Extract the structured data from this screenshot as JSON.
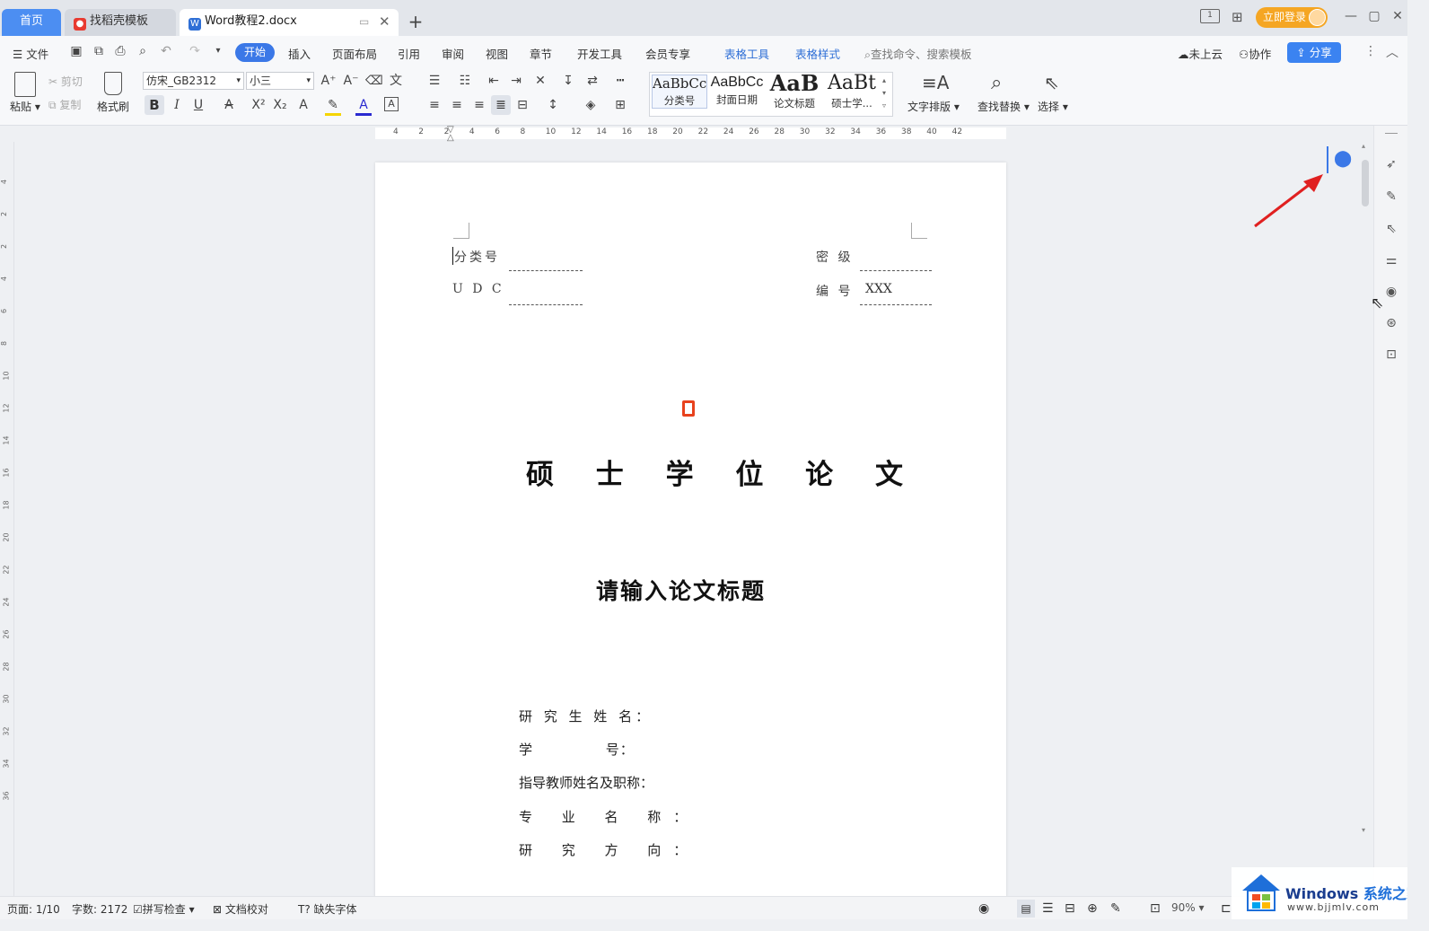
{
  "tabs": {
    "home": "首页",
    "template": "找稻壳模板",
    "document": "Word教程2.docx"
  },
  "titlebar": {
    "login": "立即登录"
  },
  "menubar": {
    "file": "文件",
    "items": [
      "开始",
      "插入",
      "页面布局",
      "引用",
      "审阅",
      "视图",
      "章节",
      "开发工具",
      "会员专享"
    ],
    "context": [
      "表格工具",
      "表格样式"
    ],
    "search_placeholder": "查找命令、搜索模板",
    "cloud": "未上云",
    "collab": "协作",
    "share": "分享"
  },
  "ribbon": {
    "paste": "粘贴",
    "cut": "剪切",
    "copy": "复制",
    "format_painter": "格式刷",
    "font_name": "仿宋_GB2312",
    "font_size": "小三",
    "styles": [
      {
        "preview": "AaBbCcI",
        "label": "分类号"
      },
      {
        "preview": "AaBbCc",
        "label": "封面日期"
      },
      {
        "preview": "AaB",
        "label": "论文标题"
      },
      {
        "preview": "AaBt",
        "label": "硕士学..."
      }
    ],
    "text_layout": "文字排版",
    "find_replace": "查找替换",
    "select": "选择"
  },
  "ruler": {
    "marks": [
      "4",
      "2",
      "2",
      "4",
      "6",
      "8",
      "10",
      "12",
      "14",
      "16",
      "18",
      "20",
      "22",
      "24",
      "26",
      "28",
      "30",
      "32",
      "34",
      "36",
      "38",
      "40",
      "42"
    ]
  },
  "vruler": {
    "marks": [
      "4",
      "2",
      "2",
      "4",
      "6",
      "8",
      "10",
      "12",
      "14",
      "16",
      "18",
      "20",
      "22",
      "24",
      "26",
      "28",
      "30",
      "32",
      "34",
      "36"
    ]
  },
  "document": {
    "class_no_label": "分类号",
    "secret_label": "密 级",
    "udc_label": "U D C",
    "number_label": "编 号",
    "number_value": "XXX",
    "main_title": "硕 士 学 位 论 文",
    "thesis_title": "请输入论文标题",
    "fields": [
      "研 究 生 姓 名：",
      "学              号：",
      "指导教师姓名及职称：",
      "专 业 名 称：",
      "研 究 方 向："
    ]
  },
  "status": {
    "page": "页面: 1/10",
    "words": "字数: 2172",
    "spell": "拼写检查",
    "proof": "文档校对",
    "missing_font": "缺失字体",
    "zoom": "90%"
  },
  "watermark": {
    "brand": "Windows",
    "suffix": "系统之家",
    "url": "www.bjjmlv.com"
  },
  "colors": {
    "accent": "#3b78e7",
    "login": "#f5a623",
    "arrow": "#e02020"
  }
}
